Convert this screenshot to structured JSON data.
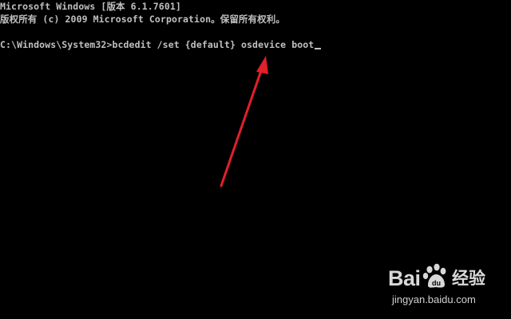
{
  "console": {
    "line1": "Microsoft Windows [版本 6.1.7601]",
    "line2": "版权所有 (c) 2009 Microsoft Corporation。保留所有权利。",
    "line3": "C:\\Windows\\System32>bcdedit /set {default} osdevice boot",
    "text_color": "#c0c0c0",
    "background": "#000000"
  },
  "annotation": {
    "arrow_color": "#e0202a"
  },
  "watermark": {
    "brand_a": "Bai",
    "brand_b": "经验",
    "url": "jingyan.baidu.com",
    "color": "#d8d8d8"
  }
}
